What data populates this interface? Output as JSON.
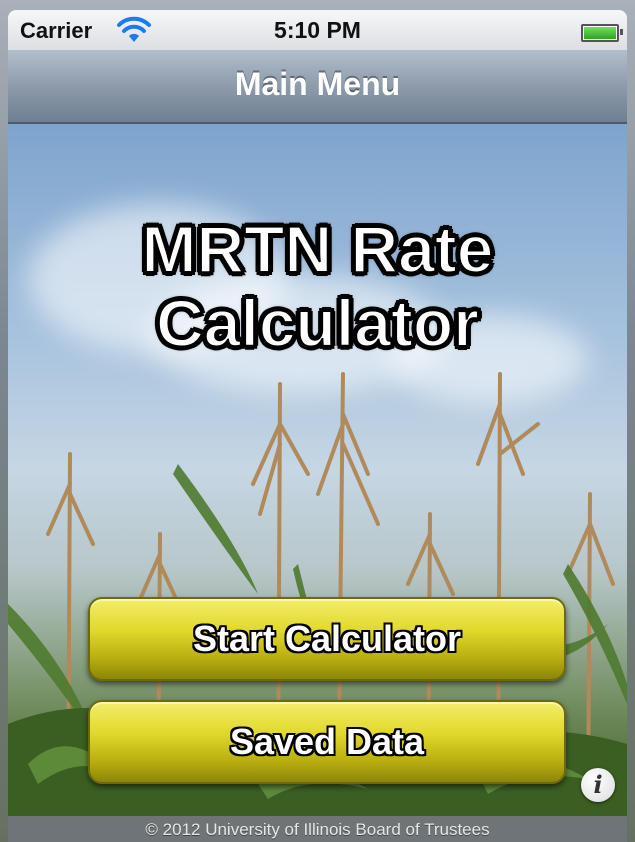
{
  "status_bar": {
    "carrier": "Carrier",
    "time": "5:10 PM",
    "wifi_icon": "wifi-icon",
    "battery_icon": "battery-icon",
    "battery_level": 1.0
  },
  "nav_bar": {
    "title": "Main Menu"
  },
  "main": {
    "app_title_line1": "MRTN Rate",
    "app_title_line2": "Calculator",
    "buttons": [
      {
        "label": "Start Calculator"
      },
      {
        "label": "Saved Data"
      }
    ],
    "info_button_icon": "info-icon"
  },
  "footer": {
    "copyright": "© 2012 University of Illinois Board of Trustees"
  },
  "colors": {
    "button_yellow": "#e0d82a",
    "nav_bar": "#8d9bab",
    "footer": "#6f7478"
  }
}
